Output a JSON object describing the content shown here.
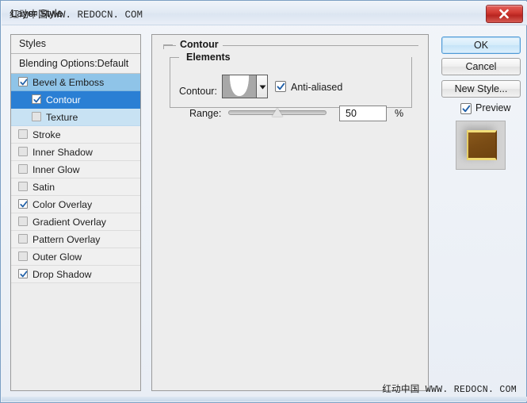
{
  "window": {
    "title": "Layer Style",
    "title_watermark_cn": "红动中国",
    "title_watermark_en": "WWW. REDOCN. COM",
    "close_label": "×"
  },
  "styles_panel": {
    "header": "Styles",
    "blending_options": "Blending Options:Default",
    "effects": [
      {
        "label": "Bevel & Emboss",
        "checked": true,
        "level": 0,
        "state": "selected-parent"
      },
      {
        "label": "Contour",
        "checked": true,
        "level": 1,
        "state": "selected"
      },
      {
        "label": "Texture",
        "checked": false,
        "level": 1,
        "state": "tinted"
      },
      {
        "label": "Stroke",
        "checked": false,
        "level": 0,
        "state": "normal"
      },
      {
        "label": "Inner Shadow",
        "checked": false,
        "level": 0,
        "state": "normal"
      },
      {
        "label": "Inner Glow",
        "checked": false,
        "level": 0,
        "state": "normal"
      },
      {
        "label": "Satin",
        "checked": false,
        "level": 0,
        "state": "normal"
      },
      {
        "label": "Color Overlay",
        "checked": true,
        "level": 0,
        "state": "normal"
      },
      {
        "label": "Gradient Overlay",
        "checked": false,
        "level": 0,
        "state": "normal"
      },
      {
        "label": "Pattern Overlay",
        "checked": false,
        "level": 0,
        "state": "normal"
      },
      {
        "label": "Outer Glow",
        "checked": false,
        "level": 0,
        "state": "normal"
      },
      {
        "label": "Drop Shadow",
        "checked": true,
        "level": 0,
        "state": "normal"
      }
    ]
  },
  "main_panel": {
    "group_title": "Contour",
    "elements": {
      "group_title": "Elements",
      "contour_label": "Contour:",
      "contour_preset": "Cone",
      "anti_aliased_label": "Anti-aliased",
      "anti_aliased_checked": true,
      "range_label": "Range:",
      "range_value": "50",
      "range_unit": "%",
      "range_percent": 50
    }
  },
  "buttons": {
    "ok": "OK",
    "cancel": "Cancel",
    "new_style": "New Style...",
    "preview_label": "Preview",
    "preview_checked": true
  },
  "watermark": {
    "cn": "红动中国",
    "en": "WWW. REDOCN. COM"
  },
  "colors": {
    "accent_selected": "#2a7fd4",
    "accent_parent": "#8fc4e8",
    "panel_bg": "#ededed",
    "close_red": "#c8342c",
    "thumb_brown": "#7a4c15",
    "thumb_gold": "#f2de7a"
  }
}
